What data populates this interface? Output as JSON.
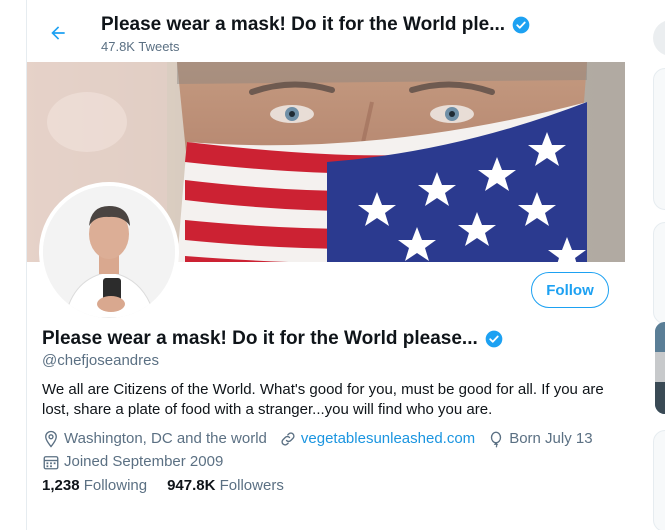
{
  "header": {
    "title": "Please wear a mask! Do it for the World ple...",
    "tweet_count": "47.8K Tweets"
  },
  "profile": {
    "name": "Please wear a mask! Do it for the World please...",
    "handle": "@chefjoseandres",
    "bio": "We all are Citizens of the World. What's good for you, must be good for all. If you are lost, share a plate of food with a stranger...you will find who you are.",
    "location": "Washington, DC and the world",
    "website": "vegetablesunleashed.com",
    "birthday": "Born July 13",
    "joined": "Joined September 2009",
    "follow_label": "Follow",
    "following_count": "1,238",
    "following_label": "Following",
    "followers_count": "947.8K",
    "followers_label": "Followers"
  },
  "icons": {
    "back": "arrow-left-icon",
    "verified": "verified-badge-icon",
    "location": "location-pin-icon",
    "link": "link-icon",
    "birthday": "balloon-icon",
    "calendar": "calendar-icon"
  },
  "colors": {
    "accent": "#1da1f2",
    "secondary_text": "#5b7083",
    "link": "#1b95e0"
  }
}
